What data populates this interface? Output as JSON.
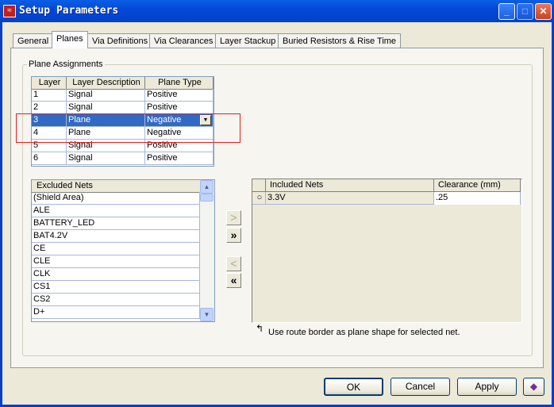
{
  "window": {
    "title": "Setup Parameters",
    "minimize": "_",
    "maximize": "□",
    "close": "✕"
  },
  "tabs": [
    {
      "label": "General"
    },
    {
      "label": "Planes",
      "active": true
    },
    {
      "label": "Via Definitions"
    },
    {
      "label": "Via Clearances"
    },
    {
      "label": "Layer Stackup"
    },
    {
      "label": "Buried Resistors & Rise Time"
    }
  ],
  "group_label": "Plane Assignments",
  "layer_table": {
    "headers": [
      "Layer",
      "Layer Description",
      "Plane Type"
    ],
    "rows": [
      [
        "1",
        "Signal",
        "Positive"
      ],
      [
        "2",
        "Signal",
        "Positive"
      ],
      [
        "3",
        "Plane",
        "Negative"
      ],
      [
        "4",
        "Plane",
        "Negative"
      ],
      [
        "5",
        "Signal",
        "Positive"
      ],
      [
        "6",
        "Signal",
        "Positive"
      ]
    ],
    "selected_row": 2
  },
  "excluded": {
    "header": "Excluded Nets",
    "items": [
      "(Shield Area)",
      "ALE",
      "BATTERY_LED",
      "BAT4.2V",
      "CE",
      "CLE",
      "CLK",
      "CS1",
      "CS2",
      "D+"
    ]
  },
  "move": {
    "add": ">",
    "add_all": "»",
    "remove": "<",
    "remove_all": "«"
  },
  "included": {
    "headers": [
      "Included Nets",
      "Clearance (mm)"
    ],
    "rows": [
      [
        "3.3V",
        ".25"
      ]
    ]
  },
  "note": "Use route border as plane shape for selected net.",
  "buttons": {
    "ok": "OK",
    "cancel": "Cancel",
    "apply": "Apply"
  },
  "colors": {
    "highlight": "#316ac5",
    "annotation": "#e02020"
  }
}
